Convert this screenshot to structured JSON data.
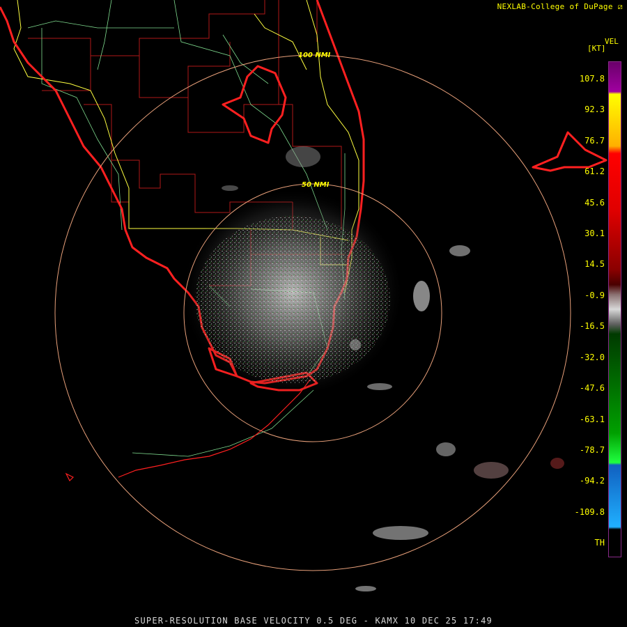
{
  "credit": {
    "text": "NEXLAB-College of DuPage",
    "logo_icon": "cod-logo-icon"
  },
  "legend": {
    "title": "VEL",
    "units": "[KT]",
    "labels": [
      "107.8",
      "92.3",
      "76.7",
      "61.2",
      "45.6",
      "30.1",
      "14.5",
      "-0.9",
      "-16.5",
      "-32.0",
      "-47.6",
      "-63.1",
      "-78.7",
      "-94.2",
      "-109.8",
      "TH"
    ],
    "colors": {
      "border": "#8a2a8a",
      "text": "#ffff00"
    }
  },
  "range_rings": {
    "inner_label": "50 NMI",
    "outer_label": "100 NMI",
    "color": "#e8a07a"
  },
  "map": {
    "coastline_color": "#ff2020",
    "county_color": "#b01818",
    "state_road_color": "#7fdc8f",
    "highway_color": "#ffff40",
    "site": "KAMX"
  },
  "footer": {
    "text": "SUPER-RESOLUTION BASE VELOCITY 0.5 DEG - KAMX 10 DEC 25 17:49"
  }
}
